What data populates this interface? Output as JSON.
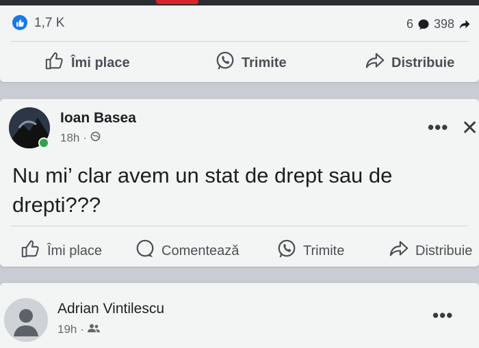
{
  "post1": {
    "reaction_count": "1,7 K",
    "comment_count": "6",
    "share_count": "398",
    "actions": {
      "like": "Îmi place",
      "send": "Trimite",
      "share": "Distribuie"
    }
  },
  "post2": {
    "author": "Ioan Basea",
    "time": "18h",
    "separator": "·",
    "text": "Nu mi’ clar avem un stat de drept sau de drepti???",
    "actions": {
      "like": "Îmi place",
      "comment": "Comentează",
      "send": "Trimite",
      "share": "Distribuie"
    },
    "more_label": "•••",
    "close_label": "✕"
  },
  "post3": {
    "author": "Adrian Vintilescu",
    "time": "19h",
    "separator": "·",
    "more_label": "•••"
  },
  "colors": {
    "accent": "#1877f2",
    "online": "#31a24c",
    "text_secondary": "#65676b"
  },
  "icons": {
    "like": "thumbs-up-icon",
    "send": "whatsapp-icon",
    "share": "share-arrow-icon",
    "comment": "comment-bubble-icon",
    "privacy_public": "globe-icon",
    "privacy_friends": "friends-icon"
  }
}
